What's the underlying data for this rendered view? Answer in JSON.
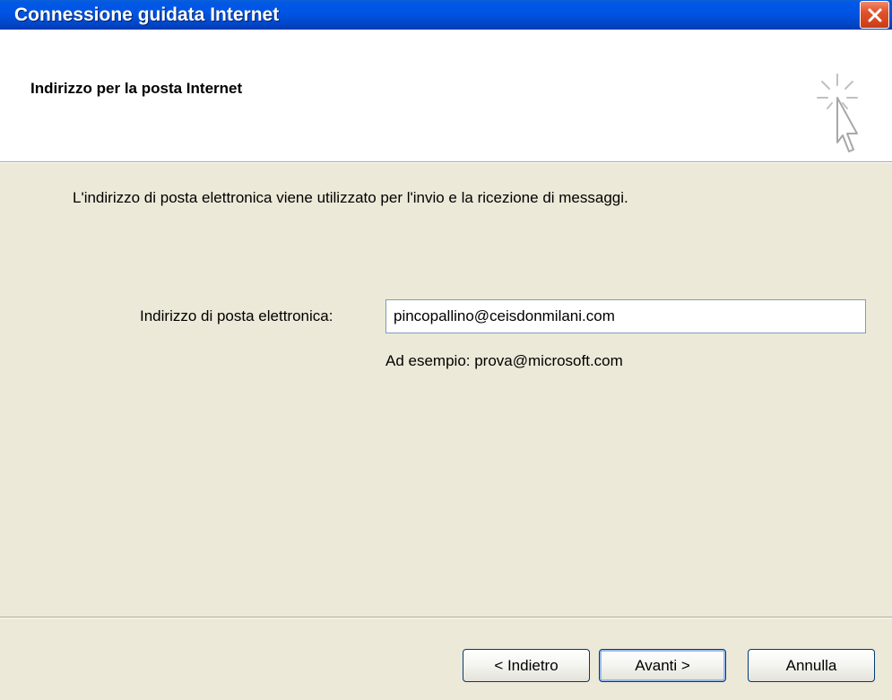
{
  "window": {
    "title": "Connessione guidata Internet",
    "close_icon": "close-icon",
    "close_color": "#e0522c"
  },
  "header": {
    "heading": "Indirizzo per la posta Internet",
    "icon": "wizard-cursor-icon"
  },
  "main": {
    "description": "L'indirizzo di posta elettronica viene utilizzato per l'invio e la ricezione di messaggi.",
    "email_label": "Indirizzo di posta elettronica:",
    "email_value": "pincopallino@ceisdonmilani.com",
    "example": "Ad esempio: prova@microsoft.com"
  },
  "buttons": {
    "back": "< Indietro",
    "next": "Avanti >",
    "cancel": "Annulla"
  },
  "colors": {
    "titlebar": "#0054e3",
    "dialog_bg": "#ece9d8",
    "header_bg": "#ffffff"
  }
}
